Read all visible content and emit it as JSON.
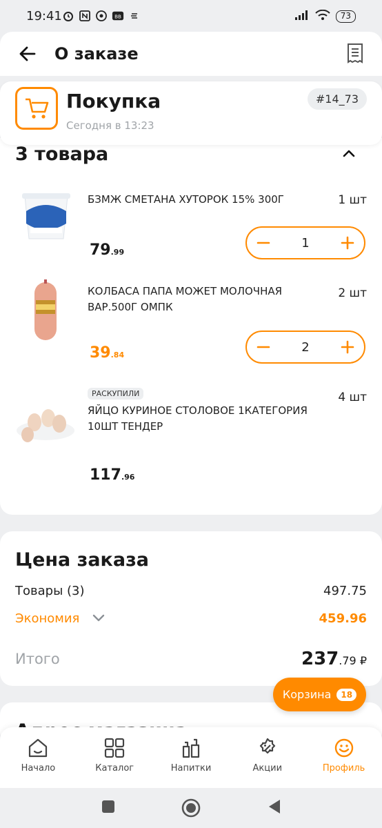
{
  "status_bar": {
    "time": "19:41",
    "battery": "73"
  },
  "header": {
    "title": "О заказе"
  },
  "order": {
    "title": "Покупка",
    "subtitle": "Сегодня в 13:23",
    "number": "#14_73"
  },
  "items_section": {
    "title": "3 товара",
    "items": [
      {
        "name": "БЗМЖ СМЕТАНА ХУТОРОК 15% 300Г",
        "qty": "1 шт",
        "price_int": "79",
        "price_cents": ".99",
        "stepper_value": "1",
        "price_color": "#1a1a1a"
      },
      {
        "name": "КОЛБАСА ПАПА МОЖЕТ МОЛОЧНАЯ ВАР.500Г ОМПК",
        "qty": "2 шт",
        "price_int": "39",
        "price_cents": ".84",
        "stepper_value": "2",
        "price_color": "#ff8a00"
      },
      {
        "name": "ЯЙЦО КУРИНОЕ СТОЛОВОЕ 1КАТЕГОРИЯ 10ШТ ТЕНДЕР",
        "qty": "4 шт",
        "price_int": "117",
        "price_cents": ".96",
        "tag": "РАСКУПИЛИ"
      }
    ]
  },
  "price_section": {
    "title": "Цена заказа",
    "goods_label": "Товары (3)",
    "goods_value": "497.75",
    "economy_label": "Экономия",
    "economy_value": "459.96",
    "total_label": "Итого",
    "total_int": "237",
    "total_cents": ".79 ₽"
  },
  "cart_button": {
    "label": "Корзина",
    "count": "18"
  },
  "address_section": {
    "title": "Адрес магазина"
  },
  "bottom_nav": [
    {
      "label": "Начало",
      "icon": "home-icon"
    },
    {
      "label": "Каталог",
      "icon": "catalog-icon"
    },
    {
      "label": "Напитки",
      "icon": "drinks-icon"
    },
    {
      "label": "Акции",
      "icon": "promo-icon"
    },
    {
      "label": "Профиль",
      "icon": "profile-icon",
      "active": true
    }
  ],
  "colors": {
    "accent": "#ff8a00",
    "muted": "#a0a4a8"
  }
}
